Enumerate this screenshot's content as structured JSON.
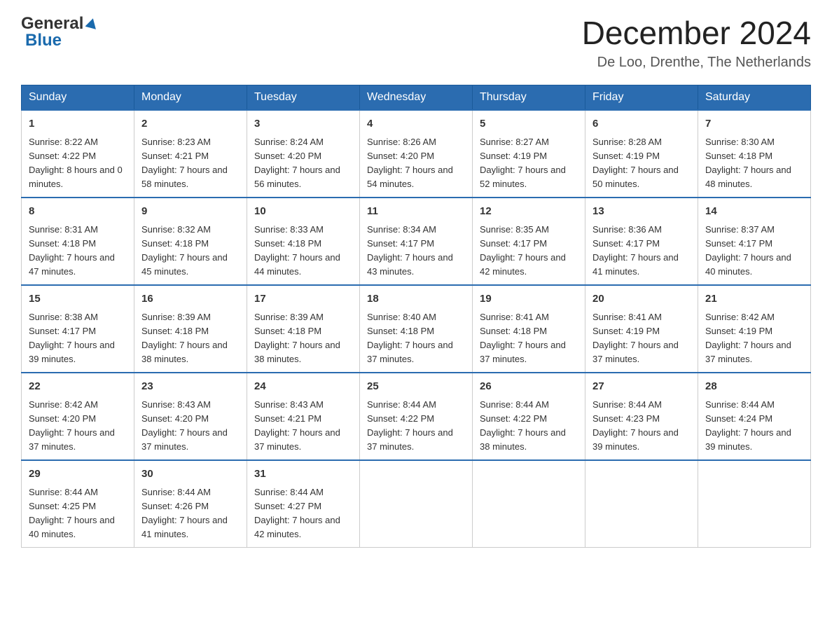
{
  "header": {
    "logo_general": "General",
    "logo_blue": "Blue",
    "month_year": "December 2024",
    "location": "De Loo, Drenthe, The Netherlands"
  },
  "weekdays": [
    "Sunday",
    "Monday",
    "Tuesday",
    "Wednesday",
    "Thursday",
    "Friday",
    "Saturday"
  ],
  "weeks": [
    [
      {
        "day": "1",
        "sunrise": "8:22 AM",
        "sunset": "4:22 PM",
        "daylight": "8 hours and 0 minutes."
      },
      {
        "day": "2",
        "sunrise": "8:23 AM",
        "sunset": "4:21 PM",
        "daylight": "7 hours and 58 minutes."
      },
      {
        "day": "3",
        "sunrise": "8:24 AM",
        "sunset": "4:20 PM",
        "daylight": "7 hours and 56 minutes."
      },
      {
        "day": "4",
        "sunrise": "8:26 AM",
        "sunset": "4:20 PM",
        "daylight": "7 hours and 54 minutes."
      },
      {
        "day": "5",
        "sunrise": "8:27 AM",
        "sunset": "4:19 PM",
        "daylight": "7 hours and 52 minutes."
      },
      {
        "day": "6",
        "sunrise": "8:28 AM",
        "sunset": "4:19 PM",
        "daylight": "7 hours and 50 minutes."
      },
      {
        "day": "7",
        "sunrise": "8:30 AM",
        "sunset": "4:18 PM",
        "daylight": "7 hours and 48 minutes."
      }
    ],
    [
      {
        "day": "8",
        "sunrise": "8:31 AM",
        "sunset": "4:18 PM",
        "daylight": "7 hours and 47 minutes."
      },
      {
        "day": "9",
        "sunrise": "8:32 AM",
        "sunset": "4:18 PM",
        "daylight": "7 hours and 45 minutes."
      },
      {
        "day": "10",
        "sunrise": "8:33 AM",
        "sunset": "4:18 PM",
        "daylight": "7 hours and 44 minutes."
      },
      {
        "day": "11",
        "sunrise": "8:34 AM",
        "sunset": "4:17 PM",
        "daylight": "7 hours and 43 minutes."
      },
      {
        "day": "12",
        "sunrise": "8:35 AM",
        "sunset": "4:17 PM",
        "daylight": "7 hours and 42 minutes."
      },
      {
        "day": "13",
        "sunrise": "8:36 AM",
        "sunset": "4:17 PM",
        "daylight": "7 hours and 41 minutes."
      },
      {
        "day": "14",
        "sunrise": "8:37 AM",
        "sunset": "4:17 PM",
        "daylight": "7 hours and 40 minutes."
      }
    ],
    [
      {
        "day": "15",
        "sunrise": "8:38 AM",
        "sunset": "4:17 PM",
        "daylight": "7 hours and 39 minutes."
      },
      {
        "day": "16",
        "sunrise": "8:39 AM",
        "sunset": "4:18 PM",
        "daylight": "7 hours and 38 minutes."
      },
      {
        "day": "17",
        "sunrise": "8:39 AM",
        "sunset": "4:18 PM",
        "daylight": "7 hours and 38 minutes."
      },
      {
        "day": "18",
        "sunrise": "8:40 AM",
        "sunset": "4:18 PM",
        "daylight": "7 hours and 37 minutes."
      },
      {
        "day": "19",
        "sunrise": "8:41 AM",
        "sunset": "4:18 PM",
        "daylight": "7 hours and 37 minutes."
      },
      {
        "day": "20",
        "sunrise": "8:41 AM",
        "sunset": "4:19 PM",
        "daylight": "7 hours and 37 minutes."
      },
      {
        "day": "21",
        "sunrise": "8:42 AM",
        "sunset": "4:19 PM",
        "daylight": "7 hours and 37 minutes."
      }
    ],
    [
      {
        "day": "22",
        "sunrise": "8:42 AM",
        "sunset": "4:20 PM",
        "daylight": "7 hours and 37 minutes."
      },
      {
        "day": "23",
        "sunrise": "8:43 AM",
        "sunset": "4:20 PM",
        "daylight": "7 hours and 37 minutes."
      },
      {
        "day": "24",
        "sunrise": "8:43 AM",
        "sunset": "4:21 PM",
        "daylight": "7 hours and 37 minutes."
      },
      {
        "day": "25",
        "sunrise": "8:44 AM",
        "sunset": "4:22 PM",
        "daylight": "7 hours and 37 minutes."
      },
      {
        "day": "26",
        "sunrise": "8:44 AM",
        "sunset": "4:22 PM",
        "daylight": "7 hours and 38 minutes."
      },
      {
        "day": "27",
        "sunrise": "8:44 AM",
        "sunset": "4:23 PM",
        "daylight": "7 hours and 39 minutes."
      },
      {
        "day": "28",
        "sunrise": "8:44 AM",
        "sunset": "4:24 PM",
        "daylight": "7 hours and 39 minutes."
      }
    ],
    [
      {
        "day": "29",
        "sunrise": "8:44 AM",
        "sunset": "4:25 PM",
        "daylight": "7 hours and 40 minutes."
      },
      {
        "day": "30",
        "sunrise": "8:44 AM",
        "sunset": "4:26 PM",
        "daylight": "7 hours and 41 minutes."
      },
      {
        "day": "31",
        "sunrise": "8:44 AM",
        "sunset": "4:27 PM",
        "daylight": "7 hours and 42 minutes."
      },
      {
        "day": "",
        "sunrise": "",
        "sunset": "",
        "daylight": ""
      },
      {
        "day": "",
        "sunrise": "",
        "sunset": "",
        "daylight": ""
      },
      {
        "day": "",
        "sunrise": "",
        "sunset": "",
        "daylight": ""
      },
      {
        "day": "",
        "sunrise": "",
        "sunset": "",
        "daylight": ""
      }
    ]
  ]
}
